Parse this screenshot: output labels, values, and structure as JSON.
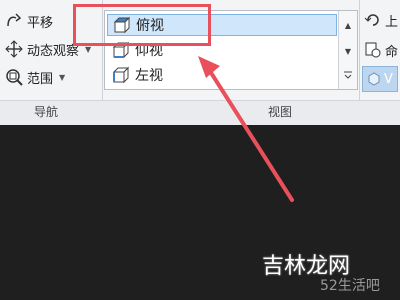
{
  "ribbon": {
    "navigation": {
      "label": "导航",
      "items": [
        {
          "label": "平移",
          "icon": "pan-icon",
          "has_dropdown": false
        },
        {
          "label": "动态观察",
          "icon": "orbit-icon",
          "has_dropdown": true
        },
        {
          "label": "范围",
          "icon": "zoom-extents-icon",
          "has_dropdown": true
        }
      ]
    },
    "views": {
      "label": "视图",
      "items": [
        {
          "label": "俯视",
          "icon": "top-view-cube-icon",
          "selected": true
        },
        {
          "label": "仰视",
          "icon": "bottom-view-cube-icon",
          "selected": false
        },
        {
          "label": "左视",
          "icon": "left-view-cube-icon",
          "selected": false
        }
      ]
    },
    "right_tools": [
      {
        "label": "上",
        "icon": "undo-icon"
      },
      {
        "label": "命",
        "icon": "named-view-icon"
      },
      {
        "label": "V",
        "icon": "viewcube-icon"
      }
    ]
  },
  "annotation": {
    "color": "#e8505b"
  },
  "watermark": {
    "brand": "吉林龙网",
    "site": "52生活吧"
  }
}
